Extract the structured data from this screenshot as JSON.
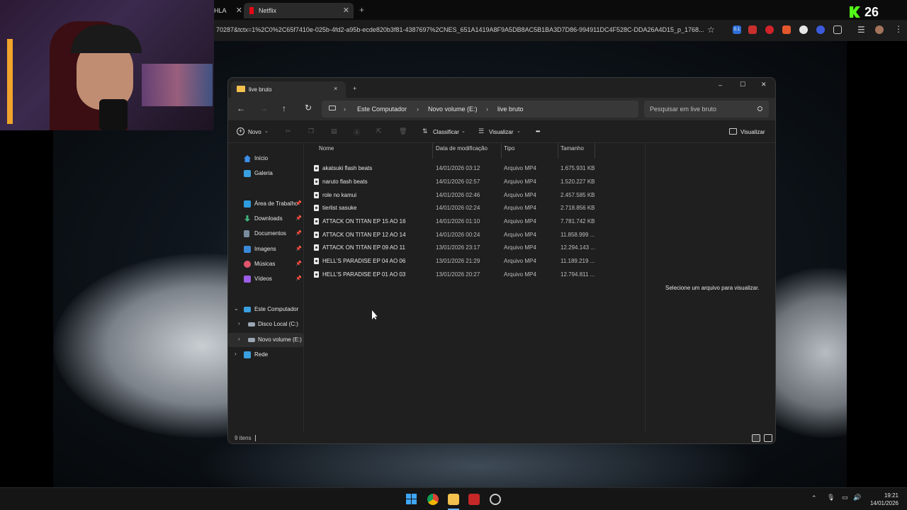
{
  "browser": {
    "tabs": [
      {
        "label": "HLA",
        "active": false
      },
      {
        "label": "Netflix",
        "active": true
      }
    ],
    "new_tab": "+",
    "url": "70287&tctx=1%2C0%2C65f7410e-025b-4fd2-a95b-ecde820b3f81-4387697%2CNES_651A1419A8F9A5DB8AC5B1BA3D7D86-994911DC4F528C-DDA26A4D15_p_1768...",
    "ext_badge": "0.1"
  },
  "overlay": {
    "kick_count": "26"
  },
  "explorer": {
    "tab_title": "live bruto",
    "tab_close": "×",
    "new_tab": "+",
    "window_controls": {
      "minimize": "–",
      "maximize": "☐",
      "close": "✕"
    },
    "nav": {
      "back": "←",
      "forward": "→",
      "up": "↑",
      "refresh": "↻"
    },
    "breadcrumb": [
      "Este Computador",
      "Novo volume (E:)",
      "live bruto"
    ],
    "search_placeholder": "Pesquisar em live bruto",
    "toolbar": {
      "new": "Novo",
      "sort": "Classificar",
      "view": "Visualizar",
      "more": "•••",
      "details": "Visualizar"
    },
    "sidebar": {
      "quick": [
        {
          "label": "Início",
          "icon": "home-icon",
          "color": "#3d8ee8",
          "pinned": false
        },
        {
          "label": "Galeria",
          "icon": "gallery-icon",
          "color": "#3aa0e0",
          "pinned": false
        }
      ],
      "pinned": [
        {
          "label": "Área de Trabalho",
          "icon": "desktop-icon",
          "color": "#2f9ce0"
        },
        {
          "label": "Downloads",
          "icon": "download-icon",
          "color": "#3fb37f"
        },
        {
          "label": "Documentos",
          "icon": "documents-icon",
          "color": "#7a8ca0"
        },
        {
          "label": "Imagens",
          "icon": "images-icon",
          "color": "#3a8ad8"
        },
        {
          "label": "Músicas",
          "icon": "music-icon",
          "color": "#e0566e"
        },
        {
          "label": "Vídeos",
          "icon": "videos-icon",
          "color": "#9b5de5"
        }
      ],
      "tree": [
        {
          "label": "Este Computador",
          "icon": "computer-icon",
          "color": "#3aa0e0",
          "expanded": true
        },
        {
          "label": "Disco Local (C:)",
          "icon": "drive-icon",
          "color": "#9aa6b2",
          "expanded": false
        },
        {
          "label": "Novo volume (E:)",
          "icon": "drive-icon",
          "color": "#9aa6b2",
          "expanded": false
        },
        {
          "label": "Rede",
          "icon": "network-icon",
          "color": "#3aa0e0",
          "expanded": false
        }
      ]
    },
    "columns": [
      "Nome",
      "Data de modificação",
      "Tipo",
      "Tamanho"
    ],
    "files": [
      {
        "name": "akatsuki flash beats",
        "date": "14/01/2026 03:12",
        "type": "Arquivo MP4",
        "size": "1.675.931 KB"
      },
      {
        "name": "naruto flash beats",
        "date": "14/01/2026 02:57",
        "type": "Arquivo MP4",
        "size": "1.520.227 KB"
      },
      {
        "name": "role no kamui",
        "date": "14/01/2026 02:46",
        "type": "Arquivo MP4",
        "size": "2.457.585 KB"
      },
      {
        "name": "tierlist sasuke",
        "date": "14/01/2026 02:24",
        "type": "Arquivo MP4",
        "size": "2.718.856 KB"
      },
      {
        "name": "ATTACK ON TITAN EP 15 AO 16",
        "date": "14/01/2026 01:10",
        "type": "Arquivo MP4",
        "size": "7.781.742 KB"
      },
      {
        "name": "ATTACK ON TITAN EP 12 AO 14",
        "date": "14/01/2026 00:24",
        "type": "Arquivo MP4",
        "size": "11.858.999 ..."
      },
      {
        "name": "ATTACK ON TITAN EP 09 AO 11",
        "date": "13/01/2026 23:17",
        "type": "Arquivo MP4",
        "size": "12.294.143 ..."
      },
      {
        "name": "HELL'S PARADISE EP 04 AO 06",
        "date": "13/01/2026 21:29",
        "type": "Arquivo MP4",
        "size": "11.189.219 ..."
      },
      {
        "name": "HELL'S PARADISE EP 01 AO 03",
        "date": "13/01/2026 20:27",
        "type": "Arquivo MP4",
        "size": "12.794.811 ..."
      }
    ],
    "preview_text": "Selecione um arquivo para visualizar.",
    "status": "9 itens"
  },
  "taskbar": {
    "time": "19:21",
    "date": "14/01/2026",
    "tray_up": "⌃"
  }
}
